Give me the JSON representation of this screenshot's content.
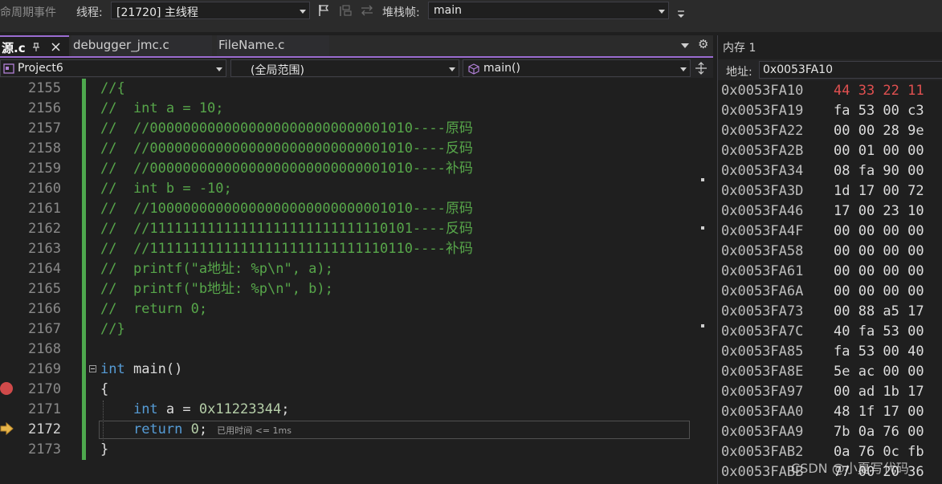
{
  "toolbar": {
    "lifecycle_label": "命周期事件",
    "thread_label": "线程:",
    "thread_value": "[21720] 主线程",
    "stack_label": "堆栈帧:",
    "stack_value": "main"
  },
  "tabs": [
    {
      "label": "源.c",
      "active": true
    },
    {
      "label": "debugger_jmc.c",
      "active": false
    },
    {
      "label": "FileName.c",
      "active": false
    }
  ],
  "navbar": {
    "project": "Project6",
    "scope": "(全局范围)",
    "function": "main()"
  },
  "editor": {
    "line_numbers": [
      "2155",
      "2156",
      "2157",
      "2158",
      "2159",
      "2160",
      "2161",
      "2162",
      "2163",
      "2164",
      "2165",
      "2166",
      "2167",
      "2168",
      "2169",
      "2170",
      "2171",
      "2172",
      "2173"
    ],
    "lines": [
      "//{",
      "//  int a = 10;",
      "//  //00000000000000000000000000001010----原码",
      "//  //00000000000000000000000000001010----反码",
      "//  //00000000000000000000000000001010----补码",
      "//  int b = -10;",
      "//  //10000000000000000000000000001010----原码",
      "//  //11111111111111111111111111110101----反码",
      "//  //11111111111111111111111111110110----补码",
      "//  printf(\"a地址: %p\\n\", a);",
      "//  printf(\"b地址: %p\\n\", b);",
      "//  return 0;",
      "//}",
      "",
      "int main()",
      "{",
      "    int a = 0x11223344;",
      "    return 0;",
      "}"
    ],
    "main_kw": "int",
    "main_name": " main()",
    "decl_kw": "int",
    "decl_rest": " a = ",
    "decl_num": "0x11223344",
    "decl_end": ";",
    "ret_kw": "return",
    "ret_num": " 0",
    "ret_end": ";",
    "elapsed_hint": "已用时间 <= 1ms"
  },
  "memory": {
    "title": "内存 1",
    "address_label": "地址:",
    "address_value": "0x0053FA10",
    "rows": [
      {
        "addr": "0x0053FA10",
        "bytes": "44 33 22 11",
        "changed": true
      },
      {
        "addr": "0x0053FA19",
        "bytes": "fa 53 00 c3",
        "changed": false
      },
      {
        "addr": "0x0053FA22",
        "bytes": "00 00 28 9e",
        "changed": false
      },
      {
        "addr": "0x0053FA2B",
        "bytes": "00 01 00 00",
        "changed": false
      },
      {
        "addr": "0x0053FA34",
        "bytes": "08 fa 90 00",
        "changed": false
      },
      {
        "addr": "0x0053FA3D",
        "bytes": "1d 17 00 72",
        "changed": false
      },
      {
        "addr": "0x0053FA46",
        "bytes": "17 00 23 10",
        "changed": false
      },
      {
        "addr": "0x0053FA4F",
        "bytes": "00 00 00 00",
        "changed": false
      },
      {
        "addr": "0x0053FA58",
        "bytes": "00 00 00 00",
        "changed": false
      },
      {
        "addr": "0x0053FA61",
        "bytes": "00 00 00 00",
        "changed": false
      },
      {
        "addr": "0x0053FA6A",
        "bytes": "00 00 00 00",
        "changed": false
      },
      {
        "addr": "0x0053FA73",
        "bytes": "00 88 a5 17",
        "changed": false
      },
      {
        "addr": "0x0053FA7C",
        "bytes": "40 fa 53 00",
        "changed": false
      },
      {
        "addr": "0x0053FA85",
        "bytes": "fa 53 00 40",
        "changed": false
      },
      {
        "addr": "0x0053FA8E",
        "bytes": "5e ac 00 00",
        "changed": false
      },
      {
        "addr": "0x0053FA97",
        "bytes": "00 ad 1b 17",
        "changed": false
      },
      {
        "addr": "0x0053FAA0",
        "bytes": "48 1f 17 00",
        "changed": false
      },
      {
        "addr": "0x0053FAA9",
        "bytes": "7b 0a 76 00",
        "changed": false
      },
      {
        "addr": "0x0053FAB2",
        "bytes": "0a 76 0c fb",
        "changed": false
      },
      {
        "addr": "0x0053FABB",
        "bytes": "77 00 20 36",
        "changed": false
      }
    ]
  },
  "watermark": "CSDN @小夏写代码",
  "colors": {
    "accent": "#9b6cd1",
    "comment": "#57a64a",
    "keyword": "#569cd6",
    "changed_byte": "#e05050",
    "breakpoint": "#d04a4a"
  }
}
